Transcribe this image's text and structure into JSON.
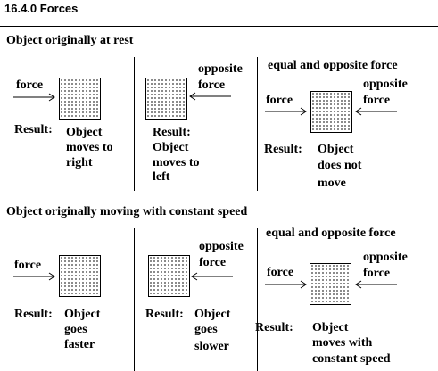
{
  "title": "16.4.0 Forces",
  "sections": [
    {
      "heading": "Object originally at rest",
      "panels": [
        {
          "force_label": "force",
          "result_label": "Result:",
          "result_lines": [
            "Object",
            "moves to",
            "right"
          ]
        },
        {
          "opposite_label_lines": [
            "opposite",
            "force"
          ],
          "result_label": "Result:",
          "result_lines": [
            "Object",
            "moves to",
            "left"
          ]
        },
        {
          "caption": "equal and opposite force",
          "force_label": "force",
          "opposite_label_lines": [
            "opposite",
            "force"
          ],
          "result_label": "Result:",
          "result_lines": [
            "Object",
            "does not",
            "move"
          ]
        }
      ]
    },
    {
      "heading": "Object originally moving with constant speed",
      "panels": [
        {
          "force_label": "force",
          "result_label": "Result:",
          "result_lines": [
            "Object",
            "goes",
            "faster"
          ]
        },
        {
          "opposite_label_lines": [
            "opposite",
            "force"
          ],
          "result_label": "Result:",
          "result_lines": [
            "Object",
            "goes",
            "slower"
          ]
        },
        {
          "caption": "equal and opposite force",
          "force_label": "force",
          "opposite_label_lines": [
            "opposite",
            "force"
          ],
          "result_label": "Result:",
          "result_lines": [
            "Object",
            "moves with",
            "constant speed"
          ]
        }
      ]
    }
  ]
}
